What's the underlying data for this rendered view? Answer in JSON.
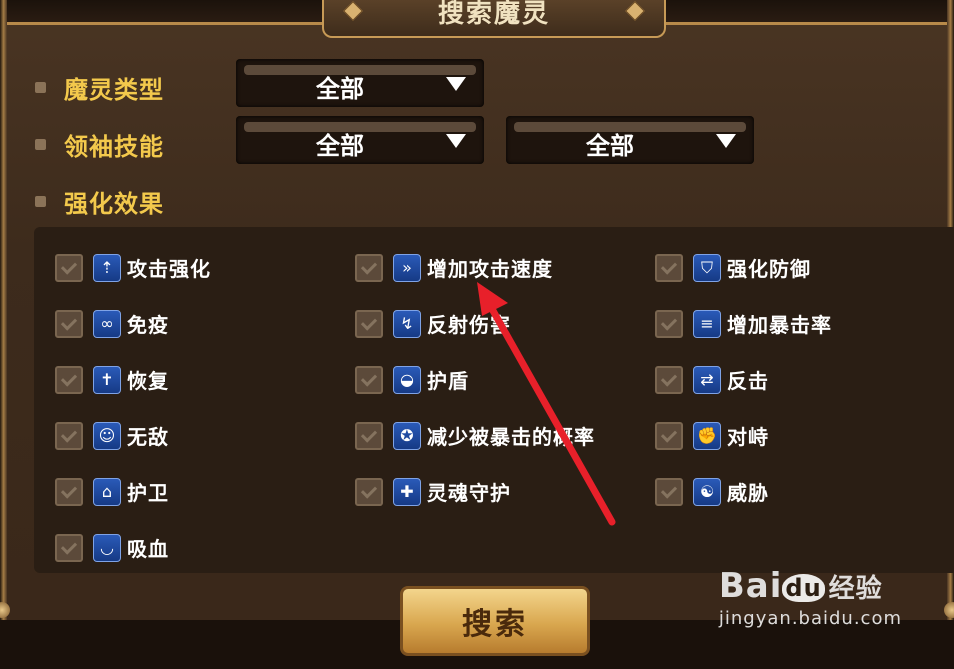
{
  "dialog": {
    "title": "搜索魔灵"
  },
  "filters": {
    "type_label": "魔灵类型",
    "type_value": "全部",
    "leader_label": "领袖技能",
    "leader_value_1": "全部",
    "leader_value_2": "全部",
    "effects_label": "强化效果"
  },
  "effects": [
    {
      "label": "攻击强化",
      "icon": "attack-up-icon"
    },
    {
      "label": "增加攻击速度",
      "icon": "attack-speed-icon"
    },
    {
      "label": "强化防御",
      "icon": "defense-up-icon"
    },
    {
      "label": "免疫",
      "icon": "immunity-icon"
    },
    {
      "label": "反射伤害",
      "icon": "reflect-damage-icon"
    },
    {
      "label": "增加暴击率",
      "icon": "crit-rate-icon"
    },
    {
      "label": "恢复",
      "icon": "recovery-icon"
    },
    {
      "label": "护盾",
      "icon": "shield-icon"
    },
    {
      "label": "反击",
      "icon": "counter-icon"
    },
    {
      "label": "无敌",
      "icon": "invincible-icon"
    },
    {
      "label": "减少被暴击的概率",
      "icon": "crit-resist-icon"
    },
    {
      "label": "对峙",
      "icon": "confrontation-icon"
    },
    {
      "label": "护卫",
      "icon": "protect-icon"
    },
    {
      "label": "灵魂守护",
      "icon": "soul-protect-icon"
    },
    {
      "label": "威胁",
      "icon": "threat-icon"
    },
    {
      "label": "吸血",
      "icon": "vampire-icon"
    }
  ],
  "search_button": "搜索",
  "watermark": {
    "brand": "Bai",
    "brand_du": "du",
    "brand_suffix": "经验",
    "url": "jingyan.baidu.com"
  },
  "colors": {
    "accent_gold": "#f3c94c",
    "annotation_arrow": "#e8202a"
  }
}
